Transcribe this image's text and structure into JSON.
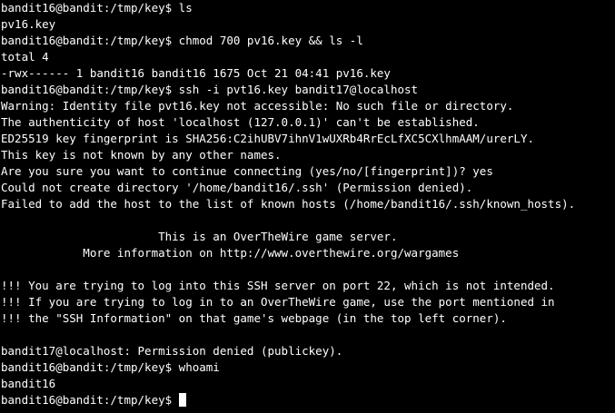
{
  "terminal": {
    "background": "#000000",
    "foreground": "#ffffff",
    "lines": [
      "bandit16@bandit:/tmp/key$ ls",
      "pv16.key",
      "bandit16@bandit:/tmp/key$ chmod 700 pv16.key && ls -l",
      "total 4",
      "-rwx------ 1 bandit16 bandit16 1675 Oct 21 04:41 pv16.key",
      "bandit16@bandit:/tmp/key$ ssh -i pvt16.key bandit17@localhost",
      "Warning: Identity file pvt16.key not accessible: No such file or directory.",
      "The authenticity of host 'localhost (127.0.0.1)' can't be established.",
      "ED25519 key fingerprint is SHA256:C2ihUBV7ihnV1wUXRb4RrEcLfXC5CXlhmAAM/urerLY.",
      "This key is not known by any other names.",
      "Are you sure you want to continue connecting (yes/no/[fingerprint])? yes",
      "Could not create directory '/home/bandit16/.ssh' (Permission denied).",
      "Failed to add the host to the list of known hosts (/home/bandit16/.ssh/known_hosts).",
      "",
      "                       This is an OverTheWire game server.",
      "            More information on http://www.overthewire.org/wargames",
      "",
      "!!! You are trying to log into this SSH server on port 22, which is not intended.",
      "!!! If you are trying to log in to an OverTheWire game, use the port mentioned in",
      "!!! the \"SSH Information\" on that game's webpage (in the top left corner).",
      "",
      "bandit17@localhost: Permission denied (publickey).",
      "bandit16@bandit:/tmp/key$ whoami",
      "bandit16"
    ],
    "prompt": "bandit16@bandit:/tmp/key$ "
  }
}
